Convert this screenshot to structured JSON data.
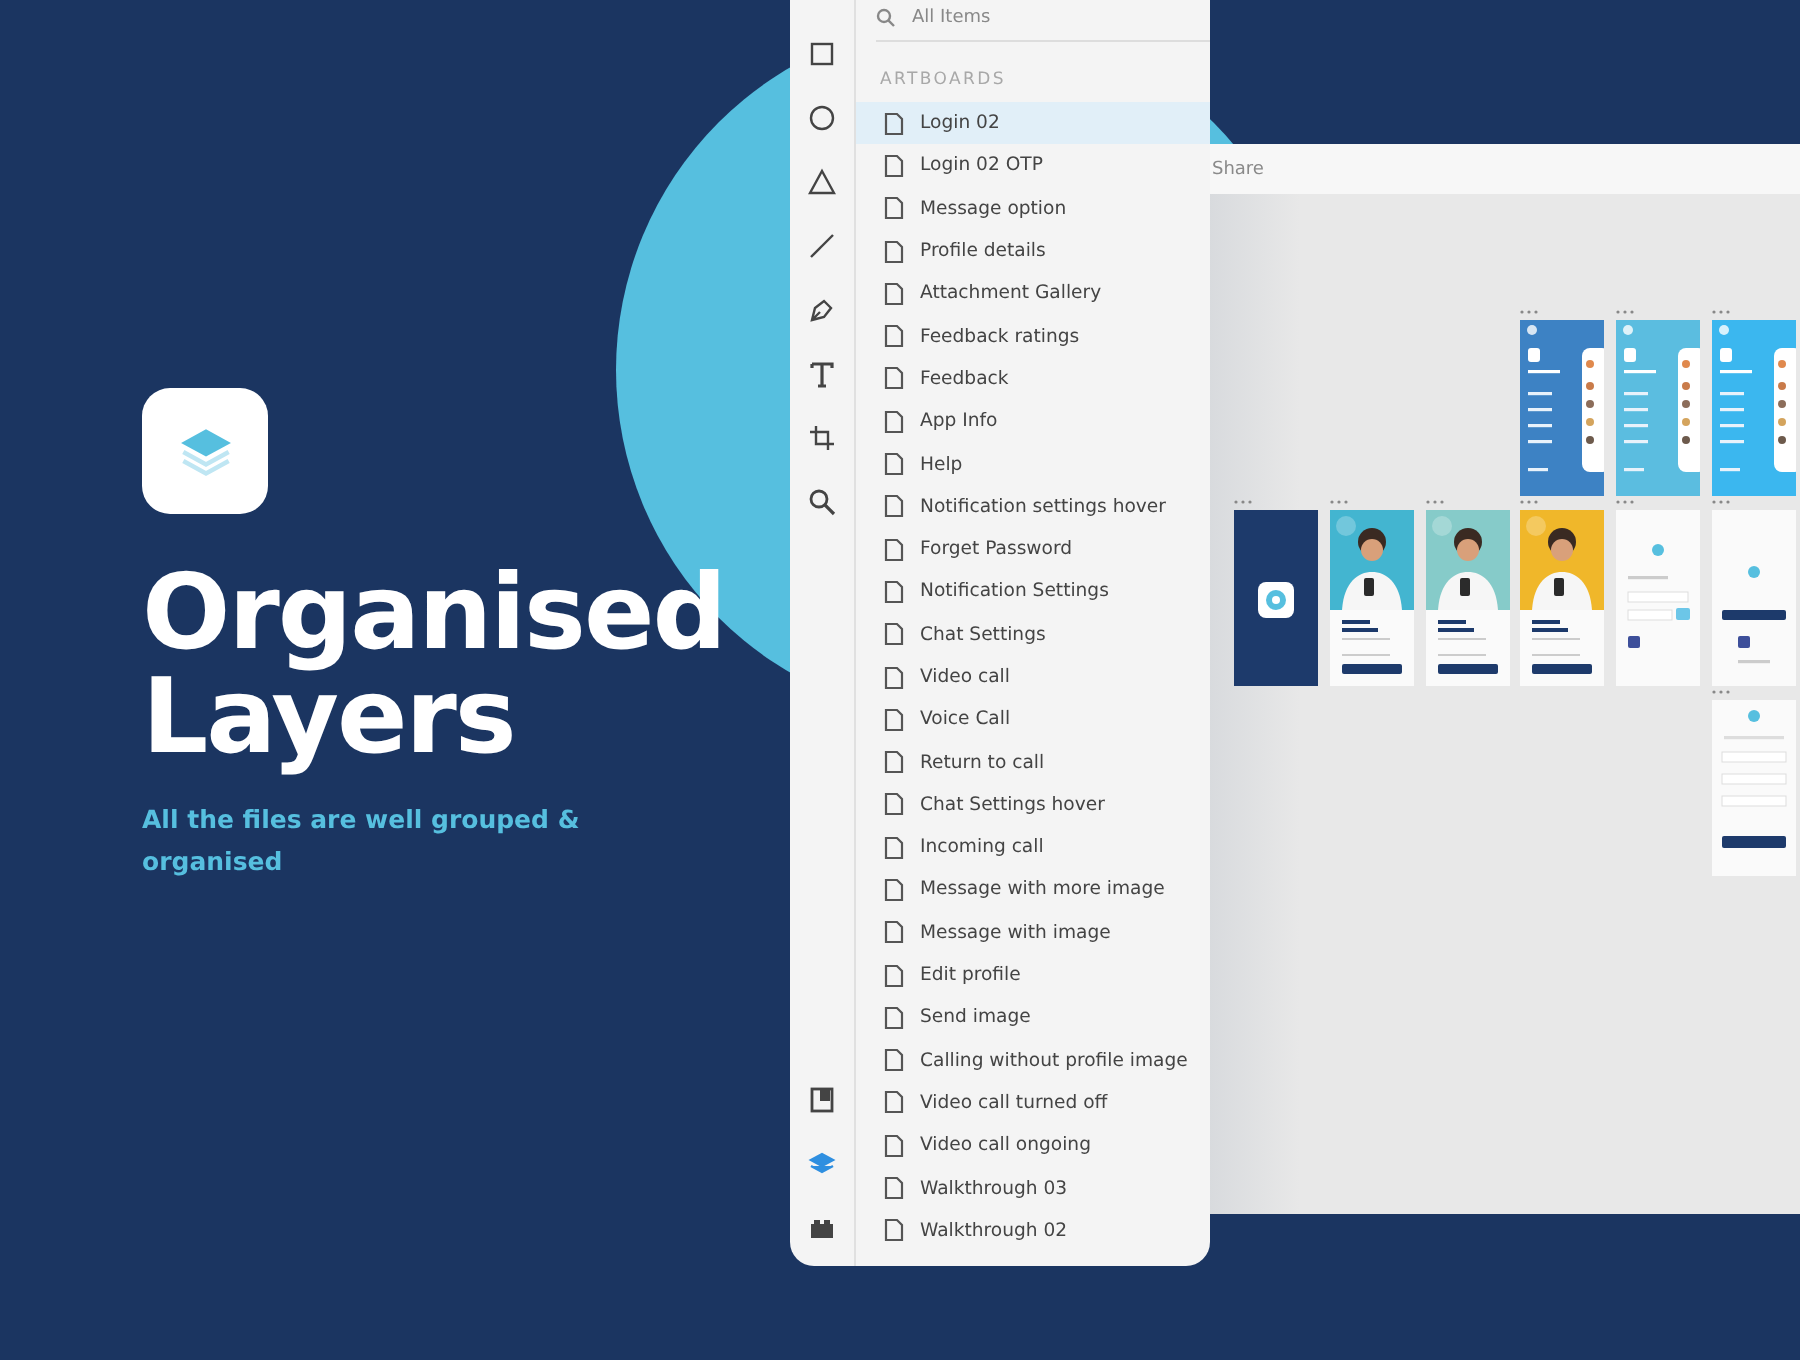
{
  "hero": {
    "title_lines": [
      "Organised",
      "Layers"
    ],
    "subtitle": "All the files are well grouped & organised"
  },
  "tools": [
    {
      "kind": "rectangle",
      "selected": false
    },
    {
      "kind": "ellipse",
      "selected": false
    },
    {
      "kind": "triangle",
      "selected": false
    },
    {
      "kind": "line",
      "selected": false
    },
    {
      "kind": "pen",
      "selected": false
    },
    {
      "kind": "text",
      "selected": false
    },
    {
      "kind": "artboard",
      "selected": false
    },
    {
      "kind": "zoom",
      "selected": false
    }
  ],
  "bottom_tools": [
    {
      "kind": "assets",
      "selected": false
    },
    {
      "kind": "layers",
      "selected": true
    },
    {
      "kind": "plugins",
      "selected": false
    }
  ],
  "layers_panel": {
    "search": {
      "placeholder": "All Items"
    },
    "section_label": "ARTBOARDS",
    "items": [
      {
        "label": "Login 02",
        "selected": true
      },
      {
        "label": "Login 02 OTP",
        "selected": false
      },
      {
        "label": "Message option",
        "selected": false
      },
      {
        "label": "Profile details",
        "selected": false
      },
      {
        "label": "Attachment Gallery",
        "selected": false
      },
      {
        "label": "Feedback ratings",
        "selected": false
      },
      {
        "label": "Feedback",
        "selected": false
      },
      {
        "label": "App Info",
        "selected": false
      },
      {
        "label": "Help",
        "selected": false
      },
      {
        "label": "Notification settings hover",
        "selected": false
      },
      {
        "label": "Forget Password",
        "selected": false
      },
      {
        "label": "Notification Settings",
        "selected": false
      },
      {
        "label": "Chat Settings",
        "selected": false
      },
      {
        "label": "Video call",
        "selected": false
      },
      {
        "label": "Voice Call",
        "selected": false
      },
      {
        "label": "Return to call",
        "selected": false
      },
      {
        "label": "Chat Settings hover",
        "selected": false
      },
      {
        "label": "Incoming call",
        "selected": false
      },
      {
        "label": "Message with more image",
        "selected": false
      },
      {
        "label": "Message with image",
        "selected": false
      },
      {
        "label": "Edit profile",
        "selected": false
      },
      {
        "label": "Send image",
        "selected": false
      },
      {
        "label": "Calling without profile image",
        "selected": false
      },
      {
        "label": "Video call turned off",
        "selected": false
      },
      {
        "label": "Video call ongoing",
        "selected": false
      },
      {
        "label": "Walkthrough 03",
        "selected": false
      },
      {
        "label": "Walkthrough 02",
        "selected": false
      }
    ]
  },
  "canvas": {
    "share_label": "Share",
    "artboard_rows": [
      [
        null,
        null,
        null,
        {
          "kind": "menu",
          "color": "#3d82c4"
        },
        {
          "kind": "menu",
          "color": "#5bbde0"
        },
        {
          "kind": "menu",
          "color": "#3bb7ef"
        }
      ],
      [
        {
          "kind": "splash"
        },
        {
          "kind": "walkthrough",
          "color": "#43b5d0"
        },
        {
          "kind": "walkthrough",
          "color": "#86cbc9"
        },
        {
          "kind": "walkthrough",
          "color": "#f0b72a"
        },
        {
          "kind": "login"
        },
        {
          "kind": "login_alt"
        }
      ],
      [
        null,
        null,
        null,
        null,
        null,
        {
          "kind": "signup"
        }
      ]
    ]
  }
}
